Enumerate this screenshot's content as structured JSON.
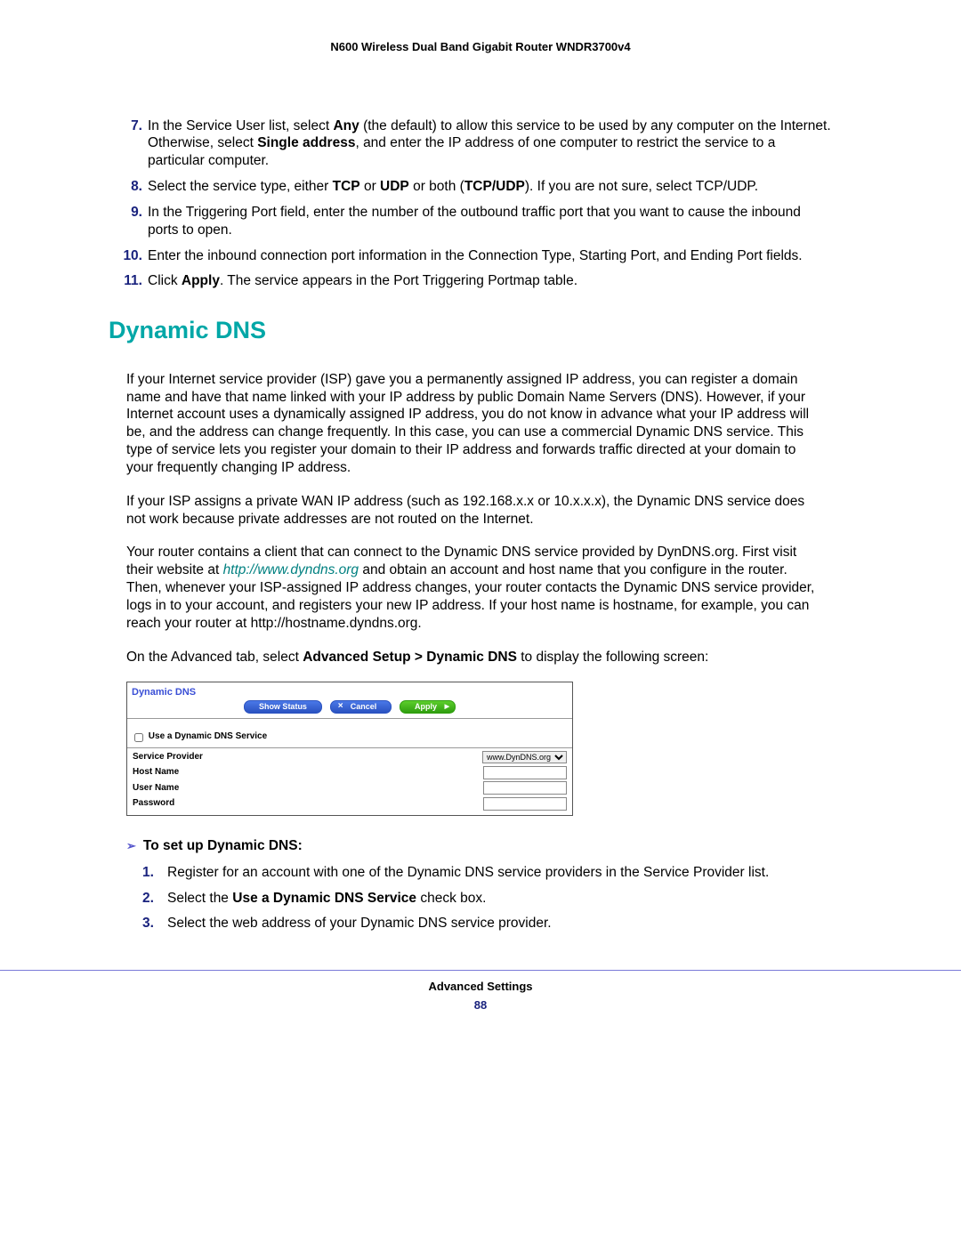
{
  "header": {
    "title": "N600 Wireless Dual Band Gigabit Router WNDR3700v4"
  },
  "steps": [
    {
      "num": "7.",
      "html": "In the Service User list, select <b>Any</b> (the default) to allow this service to be used by any computer on the Internet. Otherwise, select <b>Single address</b>, and enter the IP address of one computer to restrict the service to a particular computer."
    },
    {
      "num": "8.",
      "html": "Select the service type, either <b>TCP</b> or <b>UDP</b> or both (<b>TCP/UDP</b>). If you are not sure, select TCP/UDP."
    },
    {
      "num": "9.",
      "html": "In the Triggering Port field, enter the number of the outbound traffic port that you want to cause the inbound ports to open."
    },
    {
      "num": "10.",
      "html": "Enter the inbound connection port information in the Connection Type, Starting Port, and Ending Port fields."
    },
    {
      "num": "11.",
      "html": "Click <b>Apply</b>. The service appears in the Port Triggering Portmap table."
    }
  ],
  "h2": "Dynamic DNS",
  "para1": "If your Internet service provider (ISP) gave you a permanently assigned IP address, you can register a domain name and have that name linked with your IP address by public Domain Name Servers (DNS). However, if your Internet account uses a dynamically assigned IP address, you do not know in advance what your IP address will be, and the address can change frequently. In this case, you can use a commercial Dynamic DNS service. This type of service lets you register your domain to their IP address and forwards traffic directed at your domain to your frequently changing IP address.",
  "para2": "If your ISP assigns a private WAN IP address (such as 192.168.x.x or 10.x.x.x), the Dynamic DNS service does not work because private addresses are not routed on the Internet.",
  "para3_a": "Your router contains a client that can connect to the Dynamic DNS service provided by DynDNS.org. First visit their website at ",
  "para3_link": "http://www.dyndns.org",
  "para3_b": " and obtain an account and host name that you configure in the router. Then, whenever your ISP-assigned IP address changes, your router contacts the Dynamic DNS service provider, logs in to your account, and registers your new IP address. If your host name is hostname, for example, you can reach your router at http://hostname.dyndns.org.",
  "para4_html": "On the Advanced tab, select <b>Advanced Setup > Dynamic DNS</b> to display the following screen:",
  "panel": {
    "title": "Dynamic DNS",
    "btn_status": "Show Status",
    "btn_cancel": "Cancel",
    "btn_apply": "Apply",
    "check_label": "Use a Dynamic DNS Service",
    "rows": {
      "provider": "Service Provider",
      "provider_value": "www.DynDNS.org",
      "host": "Host Name",
      "user": "User Name",
      "pass": "Password"
    }
  },
  "proc_title": "To set up Dynamic DNS:",
  "setup": [
    {
      "num": "1.",
      "html": "Register for an account with one of the Dynamic DNS service providers in the Service Provider list."
    },
    {
      "num": "2.",
      "html": "Select the <b>Use a Dynamic DNS Service</b> check box."
    },
    {
      "num": "3.",
      "html": "Select the web address of your Dynamic DNS service provider."
    }
  ],
  "footer": {
    "title": "Advanced Settings",
    "page": "88"
  }
}
